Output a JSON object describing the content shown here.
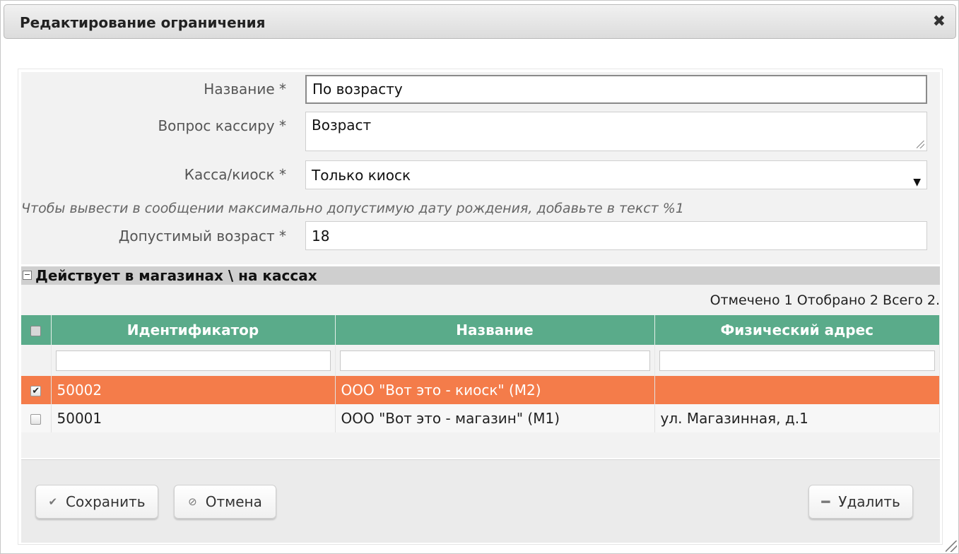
{
  "dialog": {
    "title": "Редактирование ограничения",
    "close_glyph": "✖"
  },
  "form": {
    "name_label": "Название *",
    "name_value": "По возрасту",
    "question_label": "Вопрос кассиру *",
    "question_value": "Возраст",
    "pos_label": "Касса/киоск *",
    "pos_value": "Только киоск",
    "hint": "Чтобы вывести в сообщении максимально допустимую дату рождения, добавьте в текст %1",
    "age_label": "Допустимый возраст *",
    "age_value": "18"
  },
  "section": {
    "toggle": "−",
    "title": "Действует в магазинах \\ на кассах"
  },
  "grid": {
    "counts": "Отмечено 1 Отобрано 2 Всего 2.",
    "columns": [
      "Идентификатор",
      "Название",
      "Физический адрес"
    ],
    "rows": [
      {
        "checked": true,
        "id": "50002",
        "name": "ООО \"Вот это - киоск\" (М2)",
        "address": ""
      },
      {
        "checked": false,
        "id": "50001",
        "name": "ООО \"Вот это - магазин\" (М1)",
        "address": "ул. Магазинная, д.1"
      }
    ]
  },
  "buttons": {
    "save": "Сохранить",
    "cancel": "Отмена",
    "delete": "Удалить"
  },
  "icons": {
    "close": "close-icon",
    "save": "checkmark-icon",
    "cancel": "cancel-icon",
    "delete": "minus-icon",
    "dropdown": "caret-down-icon",
    "collapse": "collapse-icon"
  },
  "colors": {
    "header_green": "#5aab8a",
    "selected_row": "#f47c4a"
  }
}
